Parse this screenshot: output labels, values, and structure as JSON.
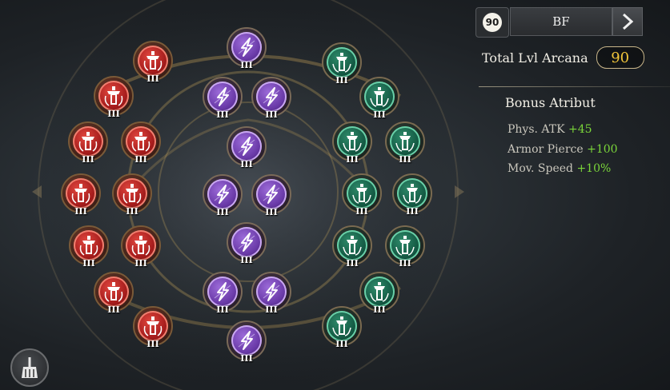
{
  "header": {
    "arcana_level_badge": "90",
    "preset_name": "BF",
    "next_icon": "chevron-right-icon"
  },
  "total": {
    "label": "Total Lvl Arcana",
    "value": "90"
  },
  "bonus": {
    "title": "Bonus Atribut",
    "items": [
      {
        "name": "Phys. ATK",
        "value": "+45"
      },
      {
        "name": "Armor Pierce",
        "value": "+100"
      },
      {
        "name": "Mov. Speed",
        "value": "+10%"
      }
    ]
  },
  "rune_level_label": "III",
  "colors": {
    "red_rune": "#c0262a",
    "purple_rune": "#7a4ac0",
    "green_rune": "#1e6e52",
    "bonus_value": "#7bd63a",
    "total_value": "#f0c43a"
  },
  "clear_button_icon": "broom-icon"
}
